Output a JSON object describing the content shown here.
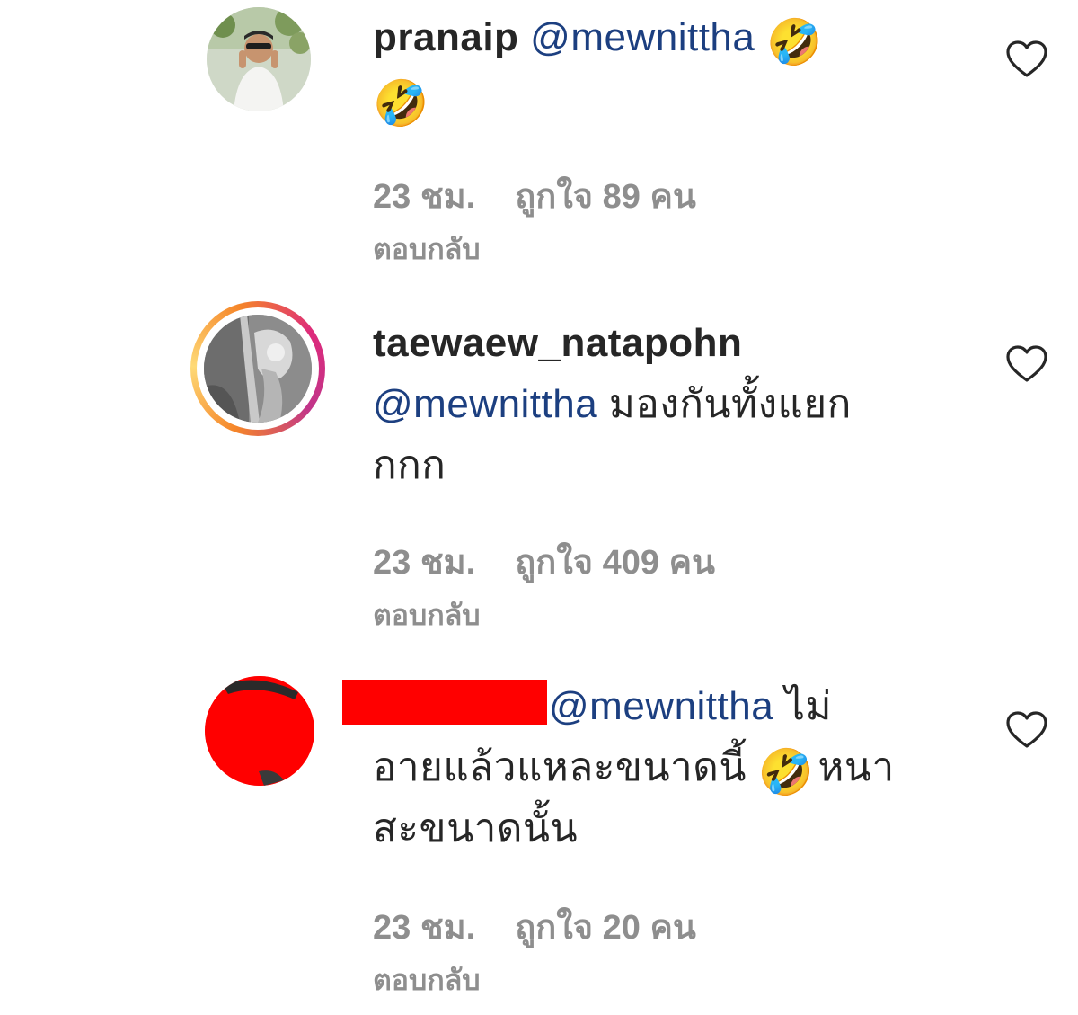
{
  "comments": [
    {
      "username": "pranaip",
      "mention": "@mewnittha",
      "text_after": "",
      "emojis_inline": "🤣",
      "emoji_line2": "🤣",
      "time": "23 ชม.",
      "likes": "ถูกใจ 89 คน",
      "reply": "ตอบกลับ"
    },
    {
      "username": "taewaew_natapohn",
      "mention": "@mewnittha",
      "text_after": " มองกันทั้งแยก",
      "text_line3": "กกก",
      "time": "23 ชม.",
      "likes": "ถูกใจ 409 คน",
      "reply": "ตอบกลับ"
    },
    {
      "mention": "@mewnittha",
      "text_after": " ไม่",
      "text_line2a": "อายแล้วแหละขนาดนี้",
      "emoji": "🤣",
      "text_line2b": " หนา",
      "text_line3": "สะขนาดนั้น",
      "time": "23 ชม.",
      "likes": "ถูกใจ 20 คน",
      "reply": "ตอบกลับ"
    }
  ],
  "colors": {
    "mention": "#1c3f80",
    "meta": "#8e8e8e",
    "story_ring_start": "#f58529",
    "story_ring_end": "#dd2a7b",
    "redaction": "#ff0000"
  }
}
